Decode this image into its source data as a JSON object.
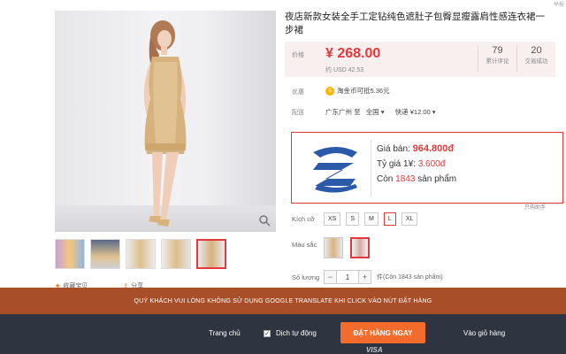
{
  "product": {
    "title": "夜店新款女装全手工定钻纯色遮肚子包臀显瘦露肩性感连衣裙一步裙",
    "corner_text": "举报"
  },
  "price_box": {
    "label": "价格",
    "price": "¥ 268.00",
    "usd": "约 USD 42.53",
    "reviews_count": "79",
    "reviews_label": "累计评论",
    "sales_count": "20",
    "sales_label": "交易成功"
  },
  "promo": {
    "label": "优惠",
    "coin_icon_text": "s",
    "text": "淘金币可抵5.36元"
  },
  "shipping": {
    "label": "配送",
    "from": "广东广州 至",
    "to": "全国 ▾",
    "method": "快递 ¥12.00 ▾"
  },
  "vn_box": {
    "price_line": "Giá bán:",
    "price_value": "964.800đ",
    "rate_line": "Tỷ giá 1¥:",
    "rate_value": "3.600đ",
    "stock_prefix": "Còn",
    "stock_value": "1843",
    "stock_suffix": "sản phẩm",
    "tag": "只购助手"
  },
  "options": {
    "size_label": "Kích cỡ",
    "sizes": [
      "XS",
      "S",
      "M",
      "L",
      "XL"
    ],
    "selected_size": "L",
    "color_label": "Màu sắc",
    "qty_label": "Số lượng",
    "qty_value": "1",
    "qty_stock": "件(Còn 1843 sản phẩm)"
  },
  "favorites": {
    "fav": "收藏宝贝",
    "share": "分享"
  },
  "warning_bar": {
    "text": "QUÝ KHÁCH VUI LÒNG KHÔNG SỬ DỤNG GOOGLE TRANSLATE KHI CLICK VÀO NÚT ĐẶT HÀNG"
  },
  "action_bar": {
    "home": "Trang chủ",
    "auto_label": "Dịch tự động",
    "auto_checked": true,
    "order_button": "ĐẶT HÀNG NGAY",
    "cart": "Vào giỏ hàng",
    "visa": "VISA"
  },
  "colors": {
    "accent_red": "#e4393c",
    "warning_bar_bg": "#a84f2a",
    "action_bar_bg": "#2e3440",
    "order_button_bg": "#f36c2c"
  }
}
